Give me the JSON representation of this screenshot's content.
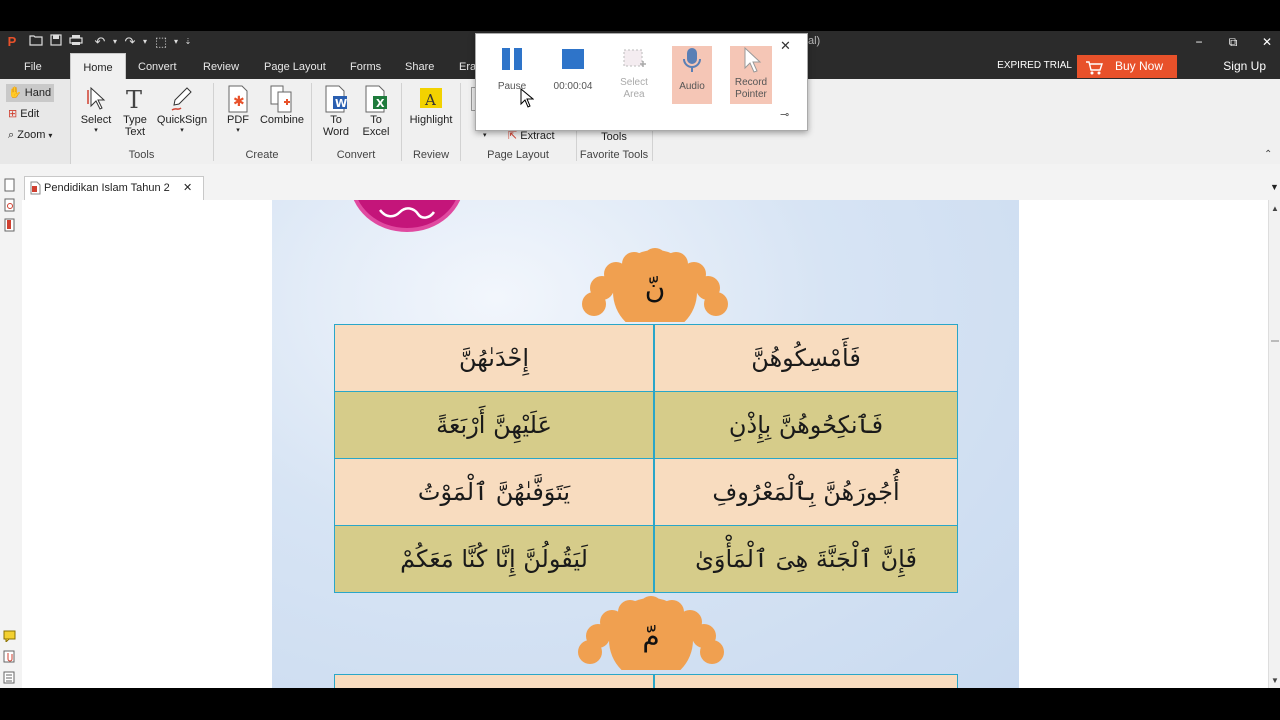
{
  "window": {
    "title_fragment": "al)",
    "controls": {
      "minimize": "−",
      "restore": "⧉",
      "close": "✕"
    }
  },
  "ribbon_tabs": [
    "File",
    "Home",
    "Convert",
    "Review",
    "Page Layout",
    "Forms",
    "Share",
    "Era"
  ],
  "active_tab": "Home",
  "header_right": {
    "expired": "EXPIRED TRIAL",
    "buy_now": "Buy Now",
    "sign_up": "Sign Up"
  },
  "left_tools": {
    "hand": "Hand",
    "edit": "Edit",
    "zoom": "Zoom"
  },
  "groups": {
    "tools": {
      "label": "Tools",
      "select": "Select",
      "type_text": "Type\nText",
      "quicksign": "QuickSign"
    },
    "create": {
      "label": "Create",
      "pdf": "PDF",
      "combine": "Combine"
    },
    "convert": {
      "label": "Convert",
      "to_word": "To\nWord",
      "to_excel": "To\nExcel"
    },
    "review": {
      "label": "Review",
      "highlight": "Highlight"
    },
    "page_layout": {
      "label": "Page Layout",
      "extract": "Extract"
    },
    "favorite": {
      "label": "Favorite Tools",
      "tools": "Tools"
    }
  },
  "document_tab": {
    "title": "Pendidikan Islam Tahun 2",
    "close": "✕"
  },
  "recorder": {
    "pause": "Pause",
    "timer": "00:00:04",
    "select_area": "Select\nArea",
    "audio": "Audio",
    "record_pointer": "Record\nPointer",
    "close": "✕"
  },
  "page": {
    "header_badge": "نّ",
    "section2_badge": "مّ",
    "table_rows": [
      {
        "right": "فَأَمْسِكُوهُنَّ",
        "left": "إِحْدَىٰهُنَّ"
      },
      {
        "right": "فَٱنكِحُوهُنَّ بِإِذْنِ",
        "left": "عَلَيْهِنَّ أَرْبَعَةً"
      },
      {
        "right": "أُجُورَهُنَّ بِٱلْمَعْرُوفِ",
        "left": "يَتَوَفَّىٰهُنَّ ٱلْمَوْتُ"
      },
      {
        "right": "فَإِنَّ ٱلْجَنَّةَ هِىَ ٱلْمَأْوَىٰ",
        "left": "لَيَقُولُنَّ إِنَّا كُنَّا مَعَكُمْ"
      }
    ]
  },
  "colors": {
    "ribbon_dark": "#2b2b2b",
    "buy_now": "#e8512a",
    "row_light": "#f8dcbf",
    "row_dark": "#d6cc8a",
    "table_border": "#2aa6c8",
    "badge": "#f0a050",
    "highlight_red": "#d42a2a"
  }
}
